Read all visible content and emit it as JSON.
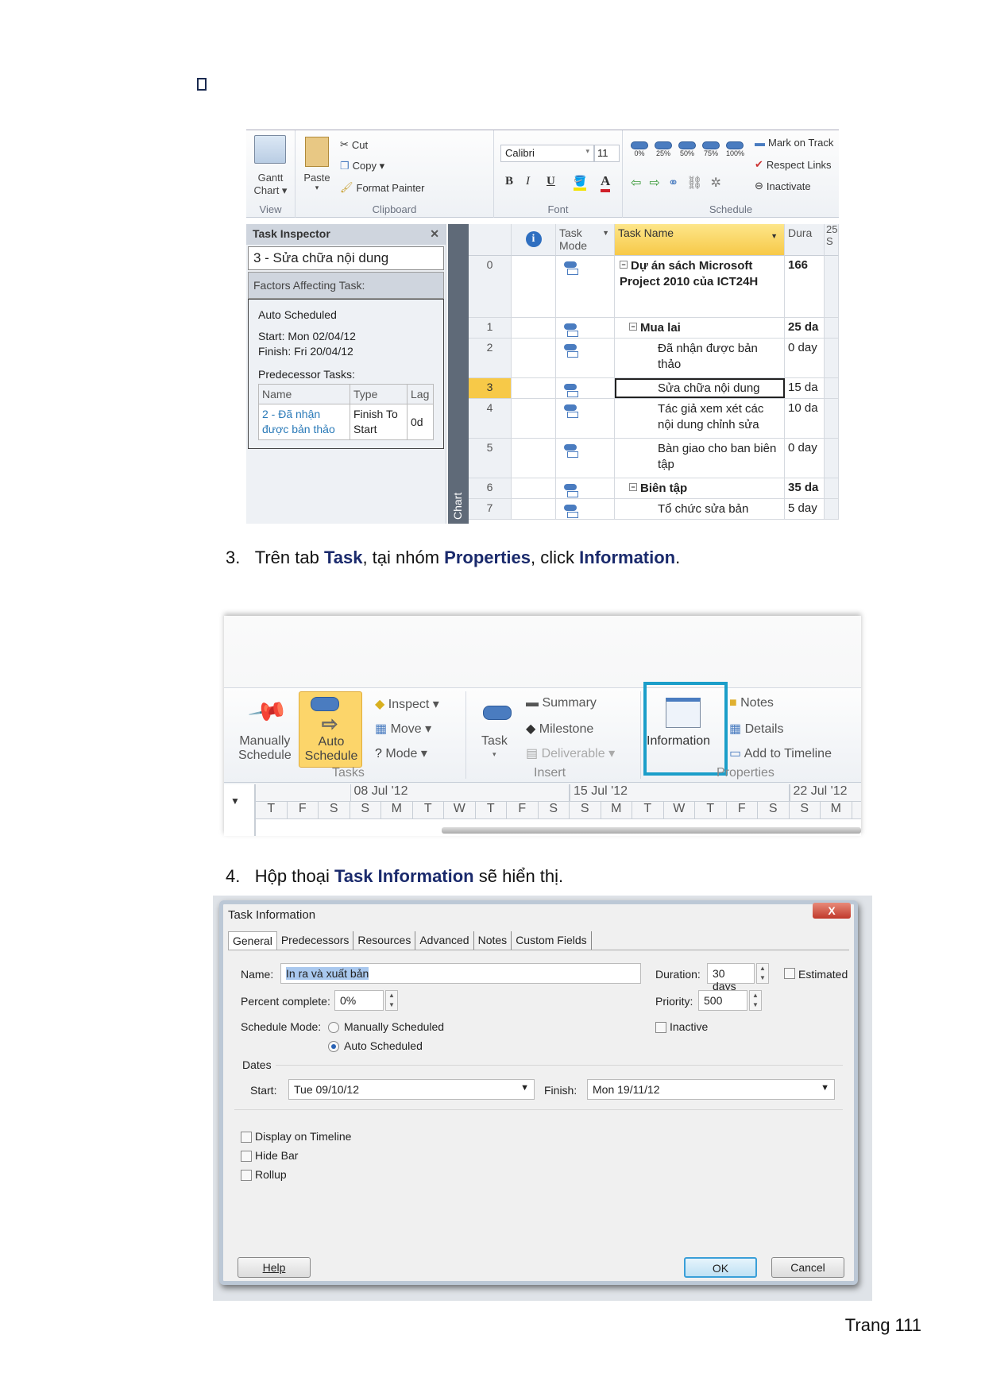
{
  "page": {
    "bullet_icon": "square-bullet",
    "step3": {
      "num": "3.",
      "pre": "Trên tab ",
      "b1": "Task",
      "mid1": ", tại nhóm ",
      "b2": "Properties",
      "mid2": ", click ",
      "b3": "Information",
      "post": "."
    },
    "step4": {
      "num": "4.",
      "pre": "Hộp thoại ",
      "b1": "Task Information",
      "post": " sẽ hiển thị."
    },
    "page_number": "Trang 111"
  },
  "shot1": {
    "ribbon": {
      "view": {
        "gantt_label1": "Gantt",
        "gantt_label2": "Chart ▾",
        "group": "View"
      },
      "clipboard": {
        "paste": "Paste",
        "cut": "Cut",
        "copy": "Copy ▾",
        "format_painter": "Format Painter",
        "group": "Clipboard"
      },
      "font": {
        "family": "Calibri",
        "size": "11",
        "bold": "B",
        "italic": "I",
        "underline": "U",
        "group": "Font"
      },
      "schedule": {
        "pcts": [
          "0%",
          "25%",
          "50%",
          "75%",
          "100%"
        ],
        "mark_on_track": "Mark on Track",
        "respect_links": "Respect Links",
        "inactivate": "Inactivate",
        "group": "Schedule"
      }
    },
    "inspector": {
      "title": "Task Inspector",
      "close": "✕",
      "task": "3 - Sửa chữa nội dung",
      "factors": "Factors Affecting Task:",
      "mode": "Auto Scheduled",
      "start": "Start: Mon 02/04/12",
      "finish": "Finish: Fri 20/04/12",
      "pred_title": "Predecessor Tasks:",
      "pred_headers": [
        "Name",
        "Type",
        "Lag"
      ],
      "pred_row": {
        "name": "2 - Đã nhận được bản thảo",
        "type": "Finish To Start",
        "lag": "0d"
      }
    },
    "chart_strip": "Chart",
    "grid": {
      "headers": {
        "info": "i",
        "mode": "Task Mode",
        "name": "Task Name",
        "dur": "Dura",
        "gantt1": "25",
        "gantt2": "S"
      },
      "rows": [
        {
          "id": "0",
          "name": "Dự án sách Microsoft Project 2010 của ICT24H",
          "dur": "166",
          "bold": true
        },
        {
          "id": "1",
          "name": "Mua lai",
          "dur": "25 da",
          "bold": true
        },
        {
          "id": "2",
          "name": "Đã nhận được bản thảo",
          "dur": "0 day"
        },
        {
          "id": "3",
          "name": "Sửa chữa nội dung",
          "dur": "15 da",
          "selected": true
        },
        {
          "id": "4",
          "name": "Tác giả xem xét các nội dung chỉnh sửa",
          "dur": "10 da"
        },
        {
          "id": "5",
          "name": "Bàn giao cho ban biên tập",
          "dur": "0 day"
        },
        {
          "id": "6",
          "name": "Biên tập",
          "dur": "35 da",
          "bold": true
        },
        {
          "id": "7",
          "name": "Tổ chức sửa bản",
          "dur": "5 day"
        }
      ]
    }
  },
  "shot2": {
    "tasks": {
      "manual1": "Manually",
      "manual2": "Schedule",
      "auto1": "Auto",
      "auto2": "Schedule",
      "inspect": "Inspect ▾",
      "move": "Move ▾",
      "mode": "Mode ▾",
      "group": "Tasks"
    },
    "insert": {
      "task": "Task",
      "task_arrow": "▾",
      "summary": "Summary",
      "milestone": "Milestone",
      "deliverable": "Deliverable ▾",
      "group": "Insert"
    },
    "properties": {
      "information": "Information",
      "notes": "Notes",
      "details": "Details",
      "add_timeline": "Add to Timeline",
      "group": "Properties"
    },
    "timeline": {
      "weeks": [
        "08 Jul '12",
        "15 Jul '12",
        "22 Jul '12"
      ],
      "days": [
        "T",
        "F",
        "S",
        "S",
        "M",
        "T",
        "W",
        "T",
        "F",
        "S",
        "S",
        "M",
        "T",
        "W",
        "T",
        "F",
        "S",
        "S",
        "M"
      ]
    }
  },
  "dialog": {
    "title": "Task Information",
    "close": "X",
    "tabs": [
      "General",
      "Predecessors",
      "Resources",
      "Advanced",
      "Notes",
      "Custom Fields"
    ],
    "name_label": "Name:",
    "name_value": "In ra và xuất bản",
    "duration_label": "Duration:",
    "duration_value": "30 days",
    "estimated_label": "Estimated",
    "percent_label": "Percent complete:",
    "percent_value": "0%",
    "priority_label": "Priority:",
    "priority_value": "500",
    "schedule_mode_label": "Schedule Mode:",
    "manual_label": "Manually Scheduled",
    "auto_label": "Auto Scheduled",
    "inactive_label": "Inactive",
    "dates_label": "Dates",
    "start_label": "Start:",
    "start_value": "Tue 09/10/12",
    "finish_label": "Finish:",
    "finish_value": "Mon 19/11/12",
    "display_timeline": "Display on Timeline",
    "hide_bar": "Hide Bar",
    "rollup": "Rollup",
    "help": "Help",
    "ok": "OK",
    "cancel": "Cancel"
  }
}
